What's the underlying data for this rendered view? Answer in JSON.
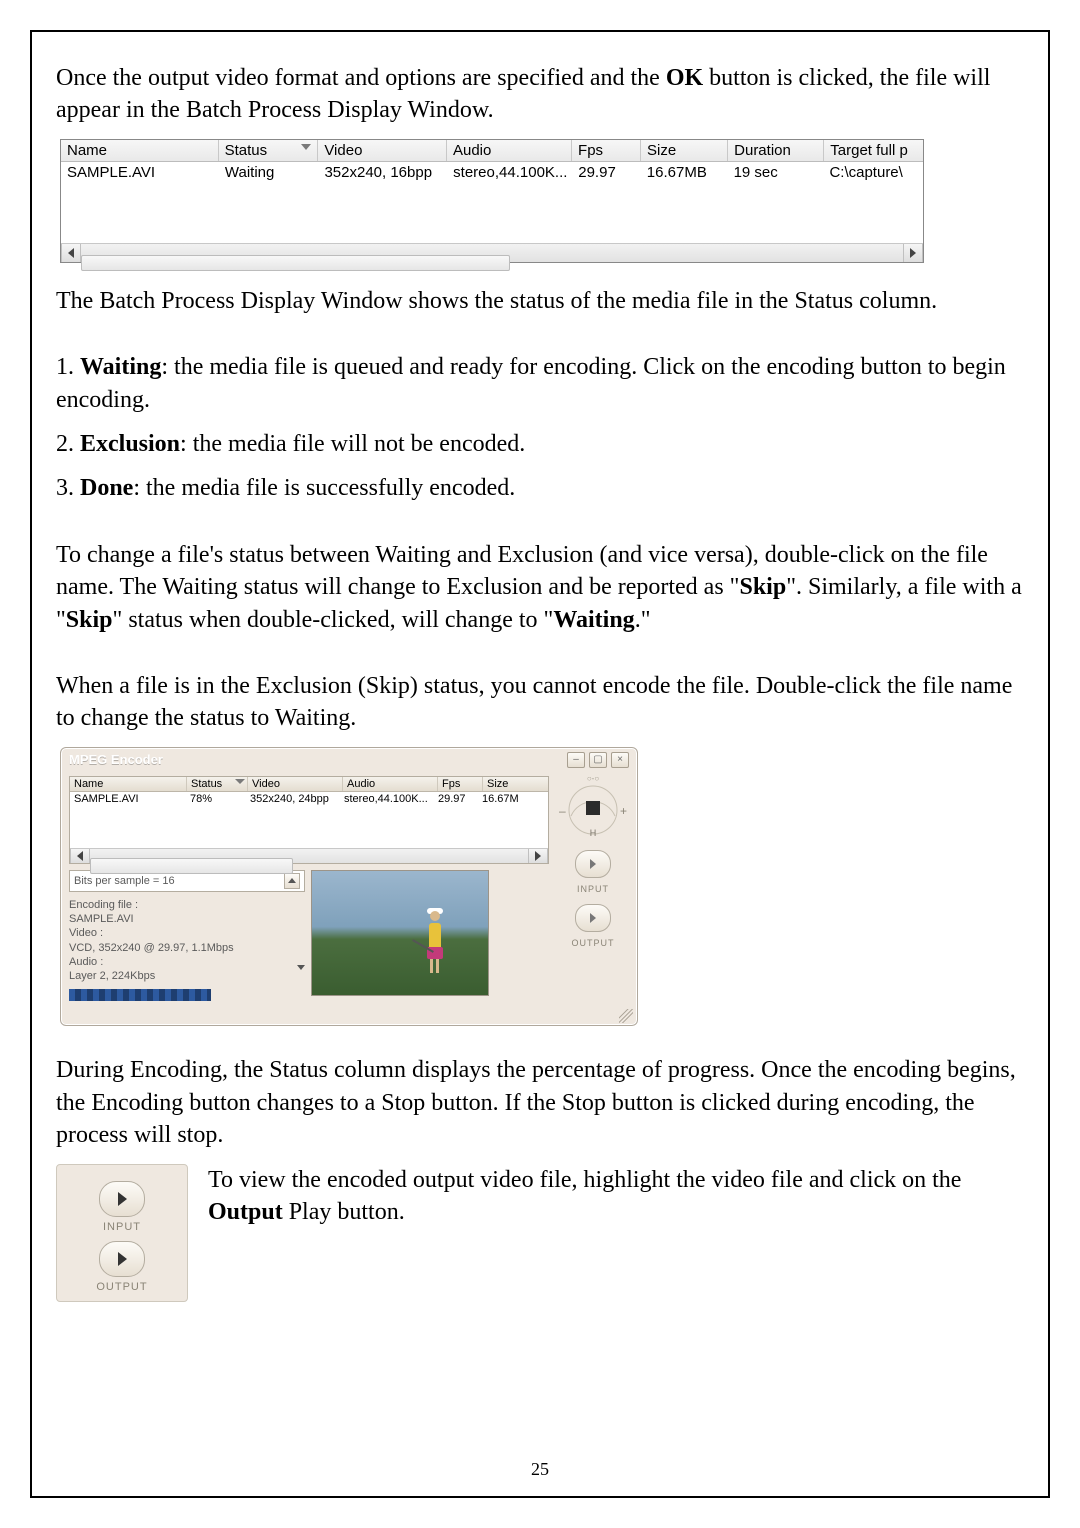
{
  "paragraphs": {
    "p1a": "Once the output video format and options are specified and the ",
    "p1b": "OK",
    "p1c": " button is clicked, the file will appear in the Batch Process Display Window.",
    "p2": "The Batch Process Display Window shows the status of the media file in the Status column.",
    "li1a": "1. ",
    "li1b": "Waiting",
    "li1c": ": the media file is queued and ready for encoding. Click on the encoding button to begin encoding.",
    "li2a": "2. ",
    "li2b": "Exclusion",
    "li2c": ": the media file will not be encoded.",
    "li3a": "3. ",
    "li3b": "Done",
    "li3c": ": the media file is successfully encoded.",
    "p3a": "To change a file's status between Waiting and Exclusion (and vice versa), double-click on the file name. The Waiting status will change to Exclusion and be reported as \"",
    "p3b": "Skip",
    "p3c": "\". Similarly, a file with a \"",
    "p3d": "Skip",
    "p3e": "\" status when double-clicked, will change to \"",
    "p3f": "Waiting",
    "p3g": ".\"",
    "p4": "When a file is in the Exclusion (Skip) status, you cannot encode the file. Double-click the file name to change the status to Waiting.",
    "p5": "During Encoding, the Status column displays the percentage of progress. Once the encoding begins, the Encoding button changes to a Stop button. If the Stop button is clicked during encoding, the process will stop.",
    "p6a": "To view the encoded output video file, highlight the video file and click on the ",
    "p6b": "Output",
    "p6c": " Play button."
  },
  "shot1": {
    "headers": {
      "name": "Name",
      "status": "Status",
      "video": "Video",
      "audio": "Audio",
      "fps": "Fps",
      "size": "Size",
      "duration": "Duration",
      "target": "Target full p"
    },
    "row": {
      "name": "SAMPLE.AVI",
      "status": "Waiting",
      "video": "352x240, 16bpp",
      "audio": "stereo,44.100K...",
      "fps": "29.97",
      "size": "16.67MB",
      "duration": "19 sec",
      "target": "C:\\capture\\"
    }
  },
  "shot2": {
    "title": "MPEG Encoder",
    "headers": {
      "name": "Name",
      "status": "Status",
      "video": "Video",
      "audio": "Audio",
      "fps": "Fps",
      "size": "Size"
    },
    "row": {
      "name": "SAMPLE.AVI",
      "status": "78%",
      "video": "352x240, 24bpp",
      "audio": "stereo,44.100K...",
      "fps": "29.97",
      "size": "16.67M"
    },
    "bits_label": "Bits per sample = 16",
    "info": {
      "l1": "Encoding file :",
      "l2": "  SAMPLE.AVI",
      "l3": "Video :",
      "l4": "  VCD, 352x240 @ 29.97, 1.1Mbps",
      "l5": "Audio :",
      "l6": "  Layer 2, 224Kbps"
    },
    "dial_h": "H",
    "dial_ceo": "○-○",
    "input_label": "INPUT",
    "output_label": "OUTPUT"
  },
  "play_inset": {
    "input_label": "INPUT",
    "output_label": "OUTPUT"
  },
  "page_number": "25"
}
